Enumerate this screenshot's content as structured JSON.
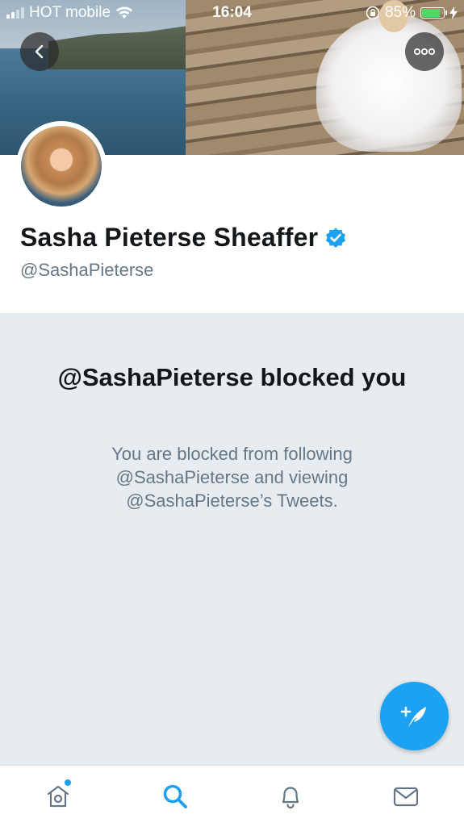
{
  "status_bar": {
    "carrier": "HOT mobile",
    "time": "16:04",
    "battery_percent": "85%",
    "battery_level": 0.85
  },
  "header": {
    "back_icon": "chevron-left-icon",
    "more_icon": "more-horizontal-icon"
  },
  "profile": {
    "display_name": "Sasha Pieterse Sheaffer",
    "verified": true,
    "handle": "@SashaPieterse"
  },
  "blocked": {
    "title": "@SashaPieterse blocked you",
    "description": "You are blocked from following @SashaPieterse and viewing @SashaPieterse’s Tweets."
  },
  "fab": {
    "icon": "compose-tweet-icon"
  },
  "tabbar": {
    "items": [
      {
        "name": "home",
        "icon": "home-icon",
        "active": false,
        "has_notification_dot": true
      },
      {
        "name": "search",
        "icon": "search-icon",
        "active": true
      },
      {
        "name": "notifications",
        "icon": "bell-icon",
        "active": false
      },
      {
        "name": "messages",
        "icon": "mail-icon",
        "active": false
      }
    ]
  },
  "colors": {
    "accent": "#1da1f2",
    "text_primary": "#14171a",
    "text_secondary": "#657786",
    "panel_bg": "#e6ecf0",
    "battery": "#4cd964"
  }
}
